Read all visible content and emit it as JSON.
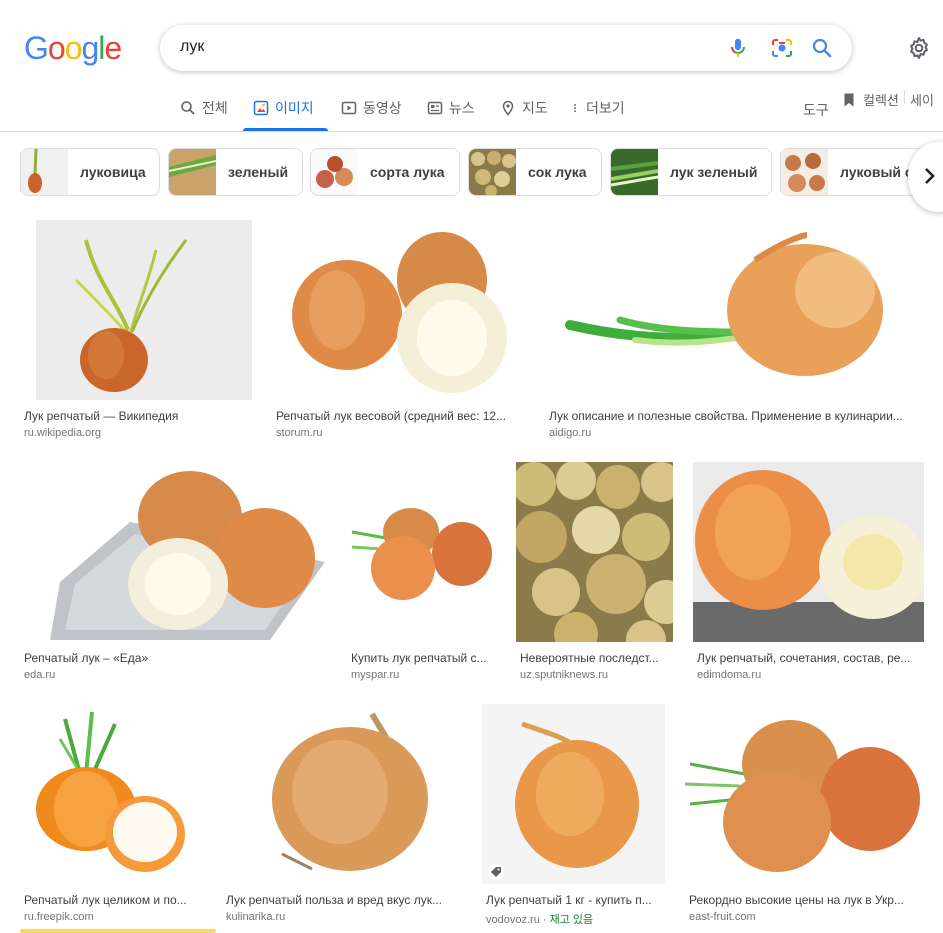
{
  "search": {
    "query": "лук"
  },
  "logo_letters": [
    {
      "ch": "G",
      "color": "#4285F4"
    },
    {
      "ch": "o",
      "color": "#EA4335"
    },
    {
      "ch": "o",
      "color": "#FBBC05"
    },
    {
      "ch": "g",
      "color": "#4285F4"
    },
    {
      "ch": "l",
      "color": "#34A853"
    },
    {
      "ch": "e",
      "color": "#EA4335"
    }
  ],
  "tabs": {
    "all": "전체",
    "images": "이미지",
    "videos": "동영상",
    "news": "뉴스",
    "maps": "지도",
    "more": "더보기",
    "tools": "도구",
    "collections": "컬렉션",
    "saved": "세이"
  },
  "chips": [
    {
      "label": "луковица"
    },
    {
      "label": "зеленый"
    },
    {
      "label": "сорта лука"
    },
    {
      "label": "сок лука"
    },
    {
      "label": "лук зеленый"
    },
    {
      "label": "луковый суп"
    }
  ],
  "results": [
    {
      "title": "Лук репчатый — Википедия",
      "site": "ru.wikipedia.org"
    },
    {
      "title": "Репчатый лук весовой (средний вес: 12...",
      "site": "storum.ru"
    },
    {
      "title": "Лук описание и полезные свойства. Применение в кулинарии...",
      "site": "aidigo.ru"
    },
    {
      "title": "Репчатый лук – «Еда»",
      "site": "eda.ru"
    },
    {
      "title": "Купить лук репчатый с...",
      "site": "myspar.ru"
    },
    {
      "title": "Невероятные последст...",
      "site": "uz.sputniknews.ru"
    },
    {
      "title": "Лук репчатый, сочетания, состав, ре...",
      "site": "edimdoma.ru"
    },
    {
      "title": "Репчатый лук целиком и по...",
      "site": "ru.freepik.com"
    },
    {
      "title": "Лук репчатый польза и вред вкус лук...",
      "site": "kulinarika.ru"
    },
    {
      "title": "Лук репчатый 1 кг - купить п...",
      "site": "vodovoz.ru",
      "stock": "재고 있음"
    },
    {
      "title": "Рекордно высокие цены на лук в Укр...",
      "site": "east-fruit.com"
    }
  ],
  "colors": {
    "accent": "#1a73e8",
    "in_stock": "#188038"
  }
}
